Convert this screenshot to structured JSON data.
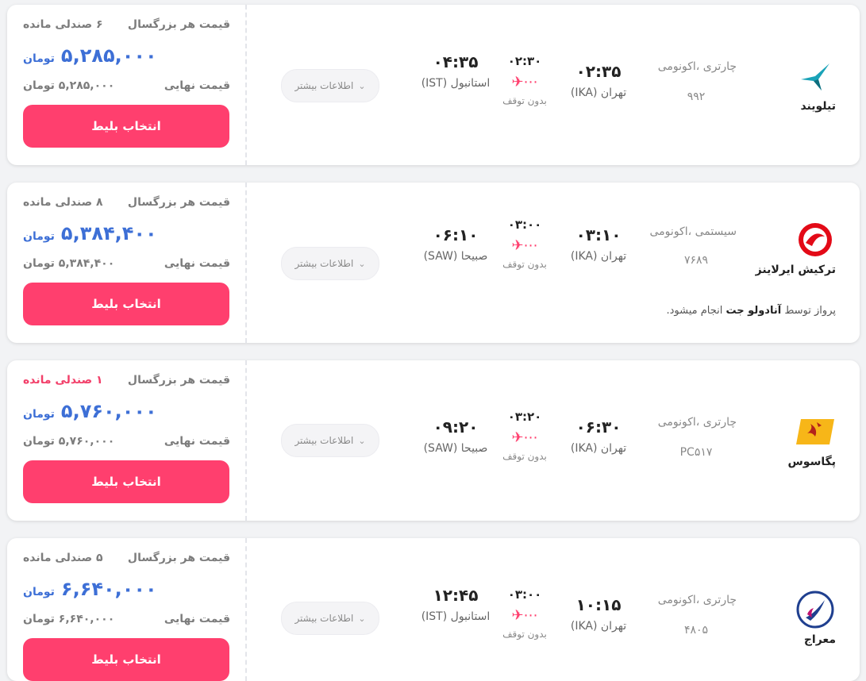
{
  "labels": {
    "per_adult": "قیمت هر بزرگسال",
    "final_price": "قیمت نهایی",
    "currency": "تومان",
    "select_ticket": "انتخاب بلیط",
    "more_info": "اطلاعات بیشتر",
    "no_stop": "بدون توقف"
  },
  "colors": {
    "accent": "#ff3f6e",
    "price": "#3d6fd6",
    "urgent": "#f2406a"
  },
  "flights": [
    {
      "airline": "تیلویند",
      "logo_icon": "tailwind-logo-icon",
      "class": "چارتری ،اکونومی",
      "flight_no": "۹۹۲",
      "dep_time": "۰۲:۳۵",
      "dep_city": "تهران (IKA)",
      "arr_time": "۰۴:۳۵",
      "arr_city": "استانبول (IST)",
      "duration": "۰۲:۳۰",
      "seats_left": "۶ صندلی مانده",
      "price": "۵,۲۸۵,۰۰۰",
      "final_price": "۵,۲۸۵,۰۰۰"
    },
    {
      "airline": "ترکیش ایرلاینز",
      "logo_icon": "turkish-airlines-logo-icon",
      "class": "سیستمی ،اکونومی",
      "flight_no": "۷۶۸۹",
      "dep_time": "۰۳:۱۰",
      "dep_city": "تهران (IKA)",
      "arr_time": "۰۶:۱۰",
      "arr_city": "صبیحا (SAW)",
      "duration": "۰۳:۰۰",
      "seats_left": "۸ صندلی مانده",
      "price": "۵,۳۸۴,۴۰۰",
      "final_price": "۵,۳۸۴,۴۰۰",
      "operated_prefix": "پرواز توسط",
      "operated_by": "آنادولو جت",
      "operated_suffix": "انجام میشود."
    },
    {
      "airline": "پگاسوس",
      "logo_icon": "pegasus-logo-icon",
      "class": "چارتری ،اکونومی",
      "flight_no": "PC۵۱۷",
      "dep_time": "۰۶:۳۰",
      "dep_city": "تهران (IKA)",
      "arr_time": "۰۹:۲۰",
      "arr_city": "صبیحا (SAW)",
      "duration": "۰۳:۲۰",
      "seats_left": "۱ صندلی مانده",
      "price": "۵,۷۶۰,۰۰۰",
      "final_price": "۵,۷۶۰,۰۰۰"
    },
    {
      "airline": "معراج",
      "logo_icon": "meraj-logo-icon",
      "class": "چارتری ،اکونومی",
      "flight_no": "۴۸۰۵",
      "dep_time": "۱۰:۱۵",
      "dep_city": "تهران (IKA)",
      "arr_time": "۱۲:۴۵",
      "arr_city": "استانبول (IST)",
      "duration": "۰۳:۰۰",
      "seats_left": "۵ صندلی مانده",
      "price": "۶,۶۴۰,۰۰۰",
      "final_price": "۶,۶۴۰,۰۰۰"
    }
  ]
}
